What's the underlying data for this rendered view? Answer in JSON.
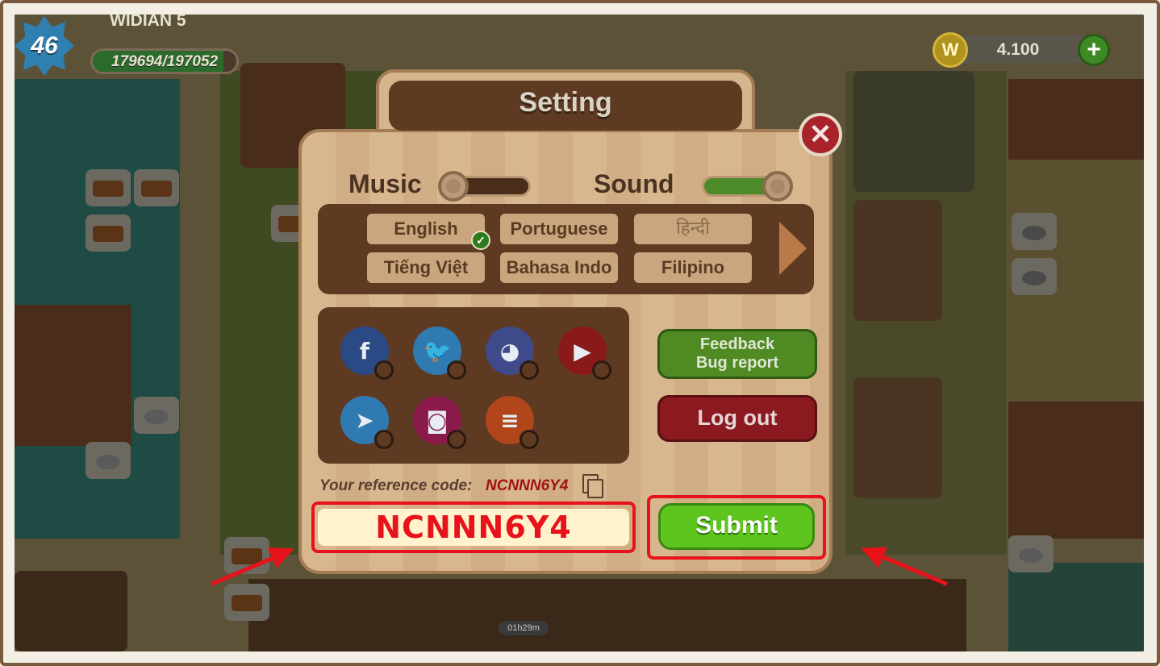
{
  "player": {
    "level": "46",
    "name": "WIDIAN 5",
    "xp_text": "179694/197052",
    "xp_progress": 0.912
  },
  "currency": {
    "coin_symbol": "W",
    "amount": "4.100",
    "add_symbol": "+"
  },
  "dialog": {
    "title": "Setting",
    "close_symbol": "✕",
    "music_label": "Music",
    "music_on": false,
    "sound_label": "Sound",
    "sound_on": true,
    "languages": [
      {
        "label": "English",
        "selected": true
      },
      {
        "label": "Portuguese",
        "selected": false
      },
      {
        "label": "हिन्दी",
        "selected": false
      },
      {
        "label": "Tiếng Việt",
        "selected": false
      },
      {
        "label": "Bahasa Indo",
        "selected": false
      },
      {
        "label": "Filipino",
        "selected": false
      }
    ],
    "social": [
      {
        "icon": "facebook-icon",
        "glyph": "f",
        "color": "#2a4a86"
      },
      {
        "icon": "twitter-icon",
        "glyph": "🐦",
        "color": "#2f7ab0"
      },
      {
        "icon": "discord-icon",
        "glyph": "◕",
        "color": "#3e4a8a"
      },
      {
        "icon": "youtube-icon",
        "glyph": "▶",
        "color": "#8a1a1a"
      },
      {
        "icon": "telegram-icon",
        "glyph": "➤",
        "color": "#2f7ab0"
      },
      {
        "icon": "instagram-icon",
        "glyph": "◙",
        "color": "#8a1a4a"
      },
      {
        "icon": "blog-icon",
        "glyph": "≡",
        "color": "#b0461a"
      }
    ],
    "feedback_line1": "Feedback",
    "feedback_line2": "Bug report",
    "logout_label": "Log out",
    "ref_label": "Your reference code:",
    "ref_code": "NCNNN6Y4",
    "input_value": "NCNNN6Y4",
    "submit_label": "Submit"
  },
  "timer": "01h29m",
  "colors": {
    "annotation_red": "#e8121a",
    "submit_green": "#5ec41e"
  }
}
